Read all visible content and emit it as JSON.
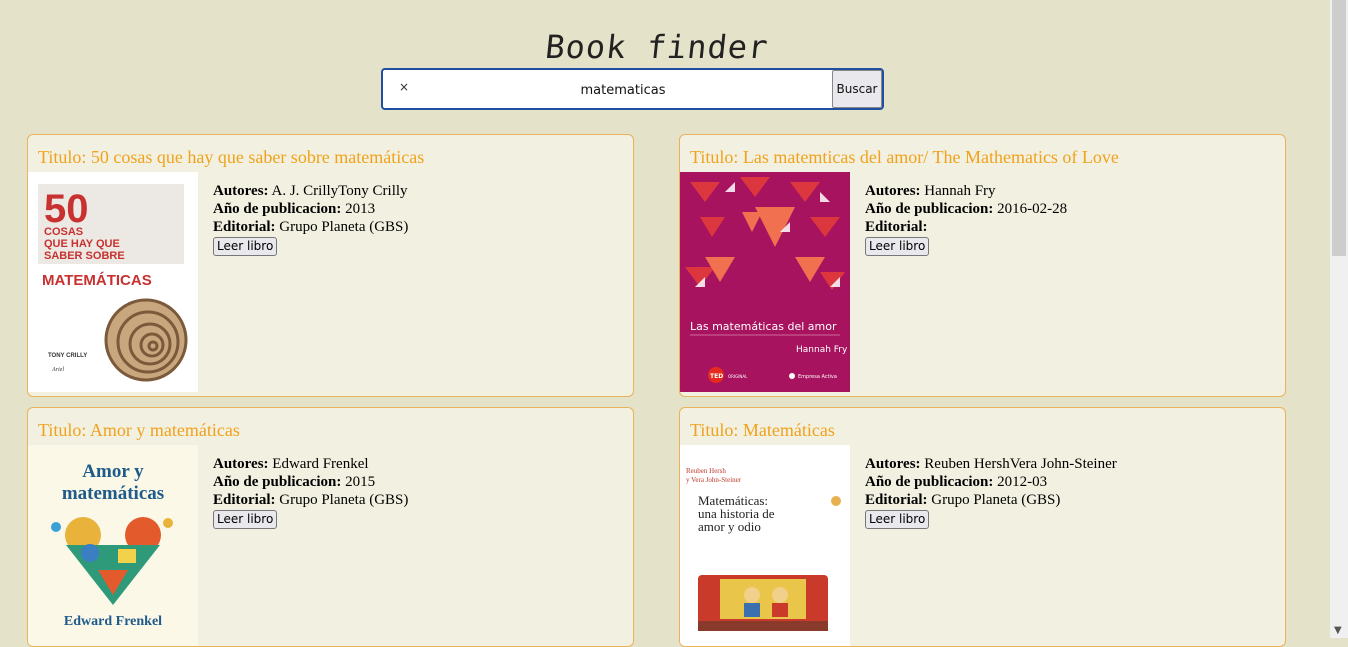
{
  "app": {
    "title": "Book finder"
  },
  "search": {
    "clear_glyph": "×",
    "value": "matematicas",
    "button_label": "Buscar"
  },
  "labels": {
    "title_prefix": "Titulo: ",
    "authors": "Autores:",
    "year": "Año de publicacion:",
    "publisher": "Editorial:",
    "read_button": "Leer libro"
  },
  "books": [
    {
      "title": "50 cosas que hay que saber sobre matemáticas",
      "authors": "A. J. CrillyTony Crilly",
      "year": "2013",
      "publisher": "Grupo Planeta (GBS)",
      "cover": {
        "big": "50",
        "lines": [
          "COSAS",
          "QUE HAY QUE",
          "SABER SOBRE"
        ],
        "main": "MATEMÁTICAS",
        "author": "TONY CRILLY",
        "imprint": "Ariel"
      }
    },
    {
      "title": "Las matemticas del amor/ The Mathematics of Love",
      "authors": "Hannah Fry",
      "year": "2016-02-28",
      "publisher": "",
      "cover": {
        "main": "Las matemáticas del amor",
        "author": "Hannah Fry",
        "badge": "TED",
        "series": "ORIGINAL",
        "imprint": "Empresa Activa"
      }
    },
    {
      "title": "Amor y matemáticas",
      "authors": "Edward Frenkel",
      "year": "2015",
      "publisher": "Grupo Planeta (GBS)",
      "cover": {
        "main_1": "Amor y",
        "main_2": "matemáticas",
        "author": "Edward Frenkel"
      }
    },
    {
      "title": "Matemáticas",
      "authors": "Reuben HershVera John-Steiner",
      "year": "2012-03",
      "publisher": "Grupo Planeta (GBS)",
      "cover": {
        "authors_1": "Reuben Hersh",
        "authors_2": "y Vera John-Steiner",
        "main_1": "Matemáticas:",
        "main_2": "una historia de",
        "main_3": "amor y odio"
      }
    }
  ]
}
